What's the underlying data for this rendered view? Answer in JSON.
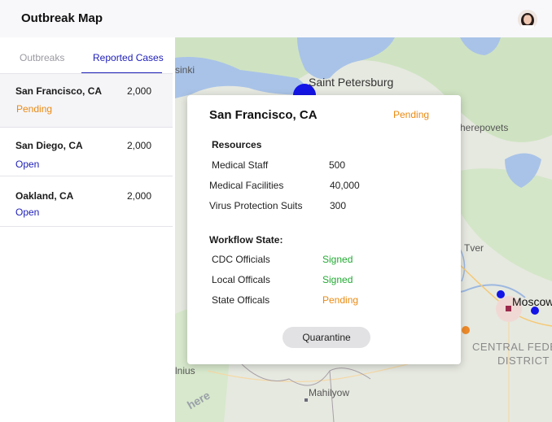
{
  "header": {
    "title": "Outbreak Map"
  },
  "tabs": [
    {
      "label": "Outbreaks"
    },
    {
      "label": "Reported Cases"
    }
  ],
  "cases": [
    {
      "name": "San Francisco, CA",
      "count": "2,000",
      "status": "Pending"
    },
    {
      "name": "San Diego, CA",
      "count": "2,000",
      "status": "Open"
    },
    {
      "name": "Oakland, CA",
      "count": "2,000",
      "status": "Open"
    }
  ],
  "map": {
    "labels": {
      "sinki": "sinki",
      "saint_petersburg": "Saint Petersburg",
      "cherepovets": "herepovets",
      "tver": "Tver",
      "moscow": "Moscow",
      "central_fed": "CENTRAL FEDE",
      "district": "DISTRICT",
      "vilnius": "lnius",
      "mahilyow": "Mahilyow",
      "attribution": "here"
    },
    "colors": {
      "water": "#a9c3e8",
      "land": "#e6e9e0",
      "forest": "#c9e0bd",
      "marker_open": "#1414e6",
      "marker_pending": "#ee8a2a"
    }
  },
  "popup": {
    "title": "San Francisco, CA",
    "status": "Pending",
    "resources": {
      "heading": "Resources",
      "rows": [
        {
          "label": "Medical Staff",
          "value": "500"
        },
        {
          "label": "Medical Facilities",
          "value": "40,000"
        },
        {
          "label": "Virus Protection Suits",
          "value": "300"
        }
      ]
    },
    "workflow": {
      "heading": "Workflow State:",
      "rows": [
        {
          "label": "CDC Officials",
          "value": "Signed"
        },
        {
          "label": "Local Officals",
          "value": "Signed"
        },
        {
          "label": "State Officals",
          "value": "Pending"
        }
      ]
    },
    "button": "Quarantine"
  }
}
